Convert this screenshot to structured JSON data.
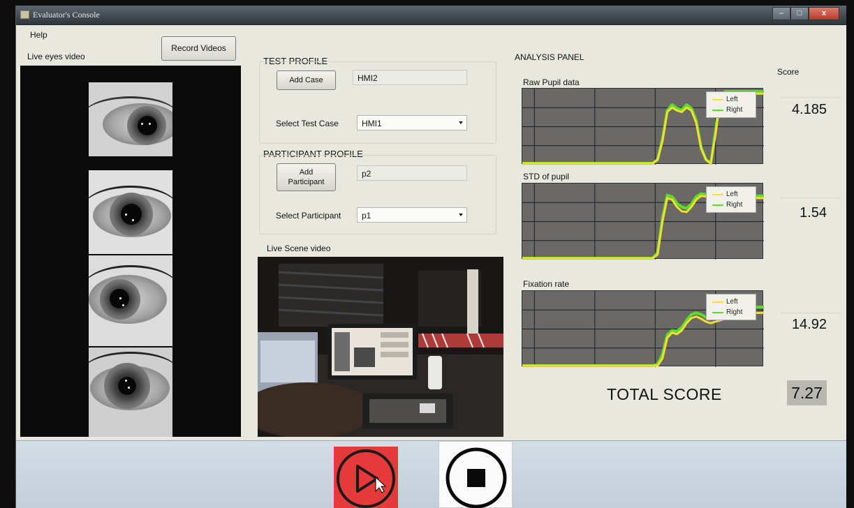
{
  "window": {
    "title": "Evaluator's Console",
    "controls": {
      "minimize": "–",
      "maximize": "□",
      "close": "x"
    }
  },
  "menu": {
    "help": "Help"
  },
  "left": {
    "record_button": "Record Videos",
    "live_eyes_label": "Live eyes video"
  },
  "test_profile": {
    "heading": "TEST PROFILE",
    "add_case_button": "Add Case",
    "case_name_value": "HMI2",
    "select_label": "Select Test Case",
    "select_value": "HMI1"
  },
  "participant_profile": {
    "heading": "PARTICIPANT PROFILE",
    "add_button_line1": "Add",
    "add_button_line2": "Participant",
    "name_value": "p2",
    "select_label": "Select Participant",
    "select_value": "p1"
  },
  "scene": {
    "label": "Live Scene video"
  },
  "analysis": {
    "heading": "ANALYSIS PANEL",
    "score_heading": "Score",
    "legend_left": "Left",
    "legend_right": "Right",
    "colors": {
      "left": "#f2e02a",
      "right": "#5fdd2c",
      "plot_bg": "#6a6968",
      "grid": "#1e1e1e"
    },
    "charts": [
      {
        "title": "Raw Pupil data",
        "score": "4.185"
      },
      {
        "title": "STD of pupil",
        "score": "1.54"
      },
      {
        "title": "Fixation rate",
        "score": "14.92"
      }
    ],
    "total_label": "TOTAL SCORE",
    "total_value": "7.27"
  },
  "chart_data": [
    {
      "type": "line",
      "title": "Raw Pupil data",
      "x": [
        0,
        0.05,
        0.1,
        0.15,
        0.2,
        0.25,
        0.3,
        0.35,
        0.4,
        0.45,
        0.5,
        0.52,
        0.54,
        0.56,
        0.58,
        0.6,
        0.62,
        0.64,
        0.66,
        0.68,
        0.7,
        0.72,
        0.74,
        0.76,
        0.78,
        0.8,
        0.82,
        0.84,
        0.86,
        0.88,
        0.9,
        0.92,
        0.94,
        0.96,
        0.98,
        1
      ],
      "series": [
        {
          "name": "Left",
          "values": [
            0,
            0,
            0,
            0,
            0,
            0,
            0,
            0,
            0,
            0,
            0,
            0,
            0,
            0.05,
            0.3,
            0.7,
            0.76,
            0.72,
            0.7,
            0.76,
            0.72,
            0.55,
            0.2,
            0.05,
            0,
            0.4,
            0.9,
            0.95,
            0.95,
            0.95,
            0.95,
            0.95,
            0.95,
            0.95,
            0.95,
            0.95
          ]
        },
        {
          "name": "Right",
          "values": [
            0,
            0,
            0,
            0,
            0,
            0,
            0,
            0,
            0,
            0,
            0,
            0,
            0,
            0.05,
            0.33,
            0.72,
            0.8,
            0.75,
            0.73,
            0.8,
            0.75,
            0.58,
            0.22,
            0.05,
            0,
            0.45,
            0.93,
            0.98,
            0.98,
            0.98,
            0.98,
            0.98,
            0.98,
            0.98,
            0.98,
            0.98
          ]
        }
      ],
      "ylim": [
        0,
        1
      ]
    },
    {
      "type": "line",
      "title": "STD of pupil",
      "x": [
        0,
        0.05,
        0.1,
        0.15,
        0.2,
        0.25,
        0.3,
        0.35,
        0.4,
        0.45,
        0.5,
        0.52,
        0.54,
        0.56,
        0.58,
        0.6,
        0.62,
        0.64,
        0.66,
        0.68,
        0.7,
        0.72,
        0.74,
        0.76,
        0.78,
        0.8,
        0.82,
        0.84,
        0.86,
        0.88,
        0.9,
        0.92,
        0.94,
        0.96,
        0.98,
        1
      ],
      "series": [
        {
          "name": "Left",
          "values": [
            0,
            0,
            0,
            0,
            0,
            0,
            0,
            0,
            0,
            0,
            0,
            0,
            0,
            0.05,
            0.5,
            0.82,
            0.8,
            0.7,
            0.64,
            0.63,
            0.7,
            0.8,
            0.85,
            0.84,
            0.82,
            0.82,
            0.82,
            0.82,
            0.82,
            0.82,
            0.82,
            0.82,
            0.82,
            0.82,
            0.82,
            0.82
          ]
        },
        {
          "name": "Right",
          "values": [
            0,
            0,
            0,
            0,
            0,
            0,
            0,
            0,
            0,
            0,
            0,
            0,
            0,
            0.08,
            0.55,
            0.86,
            0.84,
            0.75,
            0.7,
            0.68,
            0.74,
            0.84,
            0.88,
            0.87,
            0.85,
            0.85,
            0.85,
            0.85,
            0.85,
            0.85,
            0.85,
            0.85,
            0.85,
            0.85,
            0.85,
            0.85
          ]
        }
      ],
      "ylim": [
        0,
        1
      ]
    },
    {
      "type": "line",
      "title": "Fixation rate",
      "x": [
        0,
        0.05,
        0.1,
        0.15,
        0.2,
        0.25,
        0.3,
        0.35,
        0.4,
        0.45,
        0.5,
        0.52,
        0.54,
        0.56,
        0.58,
        0.6,
        0.62,
        0.64,
        0.66,
        0.68,
        0.7,
        0.72,
        0.74,
        0.76,
        0.78,
        0.8,
        0.82,
        0.84,
        0.86,
        0.88,
        0.9,
        0.92,
        0.94,
        0.96,
        0.98,
        1
      ],
      "series": [
        {
          "name": "Left",
          "values": [
            0,
            0,
            0,
            0,
            0,
            0,
            0,
            0,
            0,
            0,
            0,
            0,
            0,
            0,
            0.1,
            0.38,
            0.45,
            0.43,
            0.48,
            0.58,
            0.65,
            0.67,
            0.64,
            0.6,
            0.58,
            0.6,
            0.62,
            0.64,
            0.68,
            0.7,
            0.72,
            0.72,
            0.72,
            0.72,
            0.72,
            0.72
          ]
        },
        {
          "name": "Right",
          "values": [
            0,
            0,
            0,
            0,
            0,
            0,
            0,
            0,
            0,
            0,
            0,
            0,
            0,
            0.02,
            0.15,
            0.42,
            0.48,
            0.47,
            0.52,
            0.62,
            0.7,
            0.72,
            0.7,
            0.66,
            0.64,
            0.66,
            0.68,
            0.72,
            0.75,
            0.78,
            0.8,
            0.8,
            0.8,
            0.8,
            0.8,
            0.8
          ]
        }
      ],
      "ylim": [
        0,
        1
      ]
    }
  ],
  "controls": {
    "play": "play-button",
    "stop": "stop-button"
  }
}
